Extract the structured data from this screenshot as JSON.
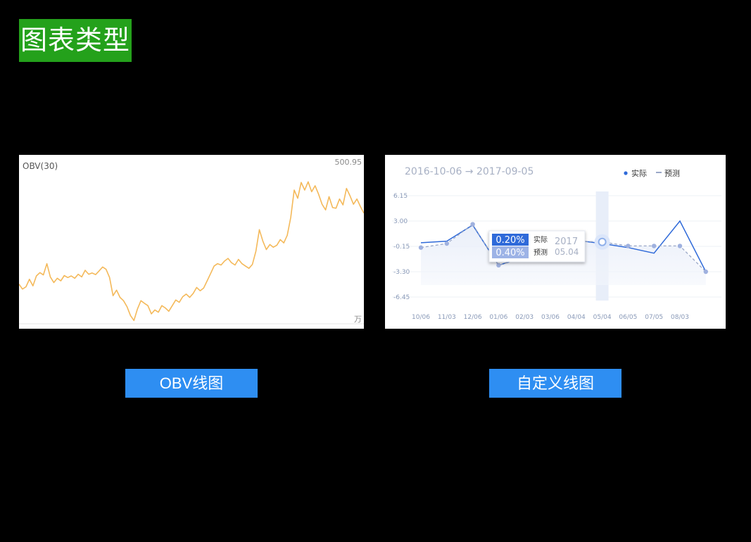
{
  "page": {
    "title": "图表类型"
  },
  "captions": {
    "obv": "OBV线图",
    "custom": "自定义线图"
  },
  "obv_chart": {
    "label": "OBV(30)",
    "max_label": "500.95",
    "unit": "万",
    "line_color": "#f4b95a"
  },
  "custom_chart": {
    "date_range": "2016-10-06 → 2017-09-05",
    "legend": {
      "actual": "实际",
      "forecast": "预测"
    },
    "tooltip": {
      "actual_value": "0.20%",
      "actual_label": "实际",
      "forecast_value": "0.40%",
      "forecast_label": "预测",
      "year": "2017",
      "date": "05.04"
    },
    "colors": {
      "actual": "#2f6ad9",
      "forecast": "#9aa8c8",
      "tooltip_actual_bg": "#2f6ad9",
      "tooltip_forecast_bg": "#9db3e6"
    }
  },
  "chart_data": [
    {
      "type": "line",
      "series": [
        {
          "name": "OBV(30)",
          "values": [
            120,
            105,
            112,
            135,
            115,
            145,
            155,
            148,
            182,
            142,
            125,
            138,
            130,
            146,
            140,
            145,
            138,
            150,
            142,
            162,
            150,
            154,
            149,
            160,
            172,
            165,
            140,
            85,
            102,
            80,
            70,
            52,
            25,
            10,
            45,
            70,
            62,
            55,
            30,
            42,
            35,
            55,
            48,
            38,
            55,
            72,
            65,
            82,
            90,
            80,
            92,
            110,
            100,
            108,
            130,
            152,
            175,
            182,
            178,
            190,
            198,
            185,
            178,
            195,
            182,
            175,
            168,
            180,
            220,
            285,
            250,
            225,
            240,
            232,
            238,
            255,
            245,
            268,
            322,
            405,
            380,
            428,
            405,
            430,
            400,
            418,
            392,
            362,
            345,
            385,
            352,
            350,
            378,
            360,
            410,
            388,
            362,
            378,
            355,
            335
          ]
        }
      ],
      "ylim": [
        0,
        500.95
      ]
    },
    {
      "type": "line",
      "categories": [
        "10/06",
        "11/03",
        "12/06",
        "01/06",
        "02/03",
        "03/06",
        "04/04",
        "05/04",
        "06/05",
        "07/05",
        "08/03",
        ""
      ],
      "series": [
        {
          "name": "实际",
          "values": [
            0.3,
            0.5,
            2.5,
            -2.5,
            null,
            null,
            0.6,
            0.2,
            -0.3,
            -1.0,
            3.0,
            -3.3
          ]
        },
        {
          "name": "预测",
          "values": [
            -0.3,
            0.2,
            2.6,
            -2.5,
            null,
            null,
            0.5,
            0.4,
            -0.1,
            -0.1,
            -0.1,
            -3.3
          ]
        }
      ],
      "yticks": [
        "6.15",
        "3.00",
        "-0.15",
        "-3.30",
        "-6.45"
      ],
      "ylim": [
        -6.45,
        6.15
      ],
      "highlight_category": "05/04"
    }
  ]
}
